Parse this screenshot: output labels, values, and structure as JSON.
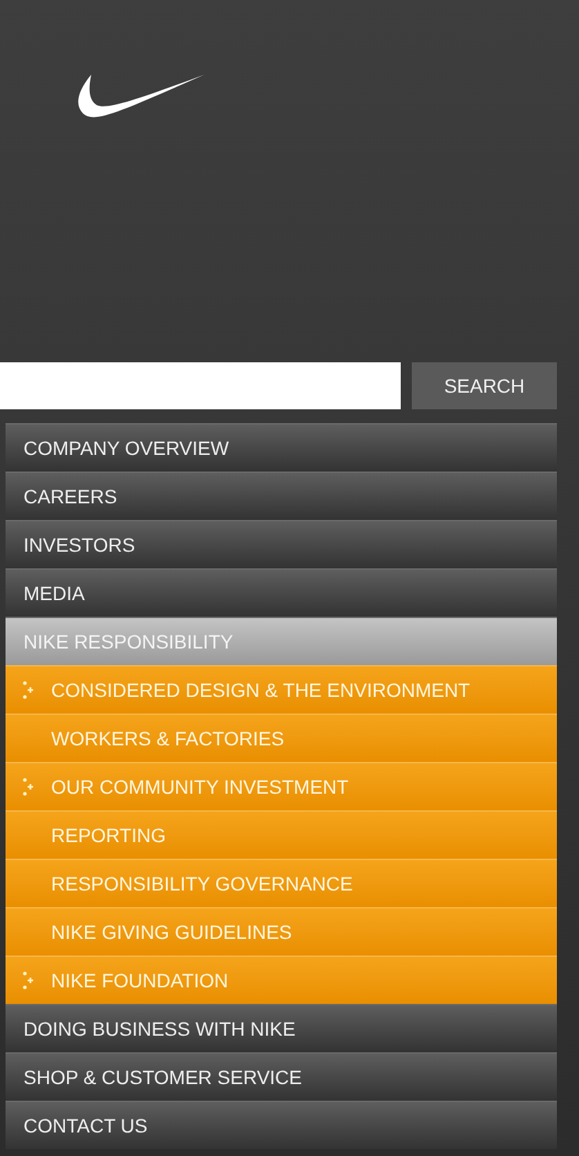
{
  "search": {
    "button": "SEARCH"
  },
  "nav": {
    "items": [
      {
        "label": "COMPANY OVERVIEW",
        "selected": false
      },
      {
        "label": "CAREERS",
        "selected": false
      },
      {
        "label": "INVESTORS",
        "selected": false
      },
      {
        "label": "MEDIA",
        "selected": false
      },
      {
        "label": "NIKE RESPONSIBILITY",
        "selected": true,
        "children": [
          {
            "label": "CONSIDERED DESIGN & THE ENVIRONMENT",
            "expandable": true
          },
          {
            "label": "WORKERS & FACTORIES",
            "expandable": false
          },
          {
            "label": "OUR COMMUNITY INVESTMENT",
            "expandable": true
          },
          {
            "label": "REPORTING",
            "expandable": false
          },
          {
            "label": "RESPONSIBILITY GOVERNANCE",
            "expandable": false
          },
          {
            "label": "NIKE GIVING GUIDELINES",
            "expandable": false
          },
          {
            "label": "NIKE FOUNDATION",
            "expandable": true
          }
        ]
      },
      {
        "label": "DOING BUSINESS WITH NIKE",
        "selected": false
      },
      {
        "label": "SHOP & CUSTOMER SERVICE",
        "selected": false
      },
      {
        "label": "CONTACT US",
        "selected": false
      }
    ]
  }
}
